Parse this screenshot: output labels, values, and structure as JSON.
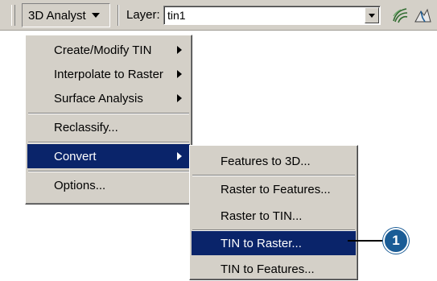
{
  "toolbar": {
    "analyst_label": "3D Analyst",
    "layer_label": "Layer:",
    "layer_value": "tin1",
    "icons": [
      "tin-contour-icon",
      "steepest-path-icon"
    ]
  },
  "main_menu": {
    "items": [
      {
        "label": "Create/Modify TIN",
        "submenu": true
      },
      {
        "label": "Interpolate to Raster",
        "submenu": true
      },
      {
        "label": "Surface Analysis",
        "submenu": true
      },
      {
        "label": "Reclassify...",
        "submenu": false
      },
      {
        "label": "Convert",
        "submenu": true,
        "highlighted": true
      },
      {
        "label": "Options...",
        "submenu": false
      }
    ]
  },
  "convert_menu": {
    "items": [
      {
        "label": "Features to 3D..."
      },
      {
        "label": "Raster to Features..."
      },
      {
        "label": "Raster to TIN..."
      },
      {
        "label": "TIN to Raster...",
        "highlighted": true
      },
      {
        "label": "TIN to Features..."
      }
    ]
  },
  "callout": {
    "number": "1"
  },
  "colors": {
    "highlight": "#0a246a",
    "callout": "#1a5c96",
    "chrome": "#d4d0c8"
  }
}
